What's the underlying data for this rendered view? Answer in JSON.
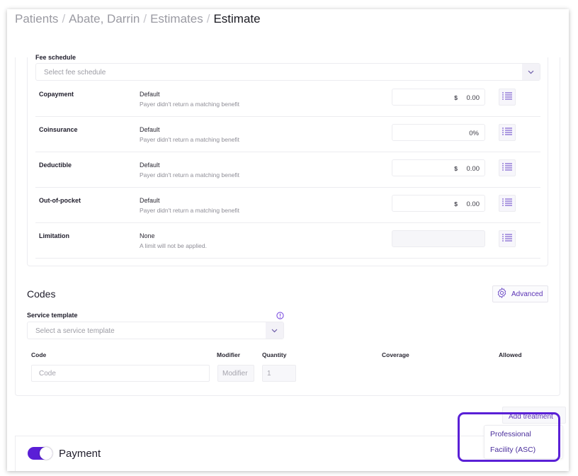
{
  "breadcrumb": {
    "items": [
      "Patients",
      "Abate, Darrin",
      "Estimates"
    ],
    "current": "Estimate",
    "separator": "/"
  },
  "fee_schedule": {
    "label": "Fee schedule",
    "placeholder": "Select fee schedule"
  },
  "benefits": [
    {
      "name": "Copayment",
      "value": "Default",
      "note": "Payer didn't return a matching benefit",
      "currency": "$",
      "amount": "0.00"
    },
    {
      "name": "Coinsurance",
      "value": "Default",
      "note": "Payer didn't return a matching benefit",
      "percent": "0%"
    },
    {
      "name": "Deductible",
      "value": "Default",
      "note": "Payer didn't return a matching benefit",
      "currency": "$",
      "amount": "0.00"
    },
    {
      "name": "Out-of-pocket",
      "value": "Default",
      "note": "Payer didn't return a matching benefit",
      "currency": "$",
      "amount": "0.00"
    },
    {
      "name": "Limitation",
      "value": "None",
      "note": "A limit will not be applied.",
      "amount": ""
    }
  ],
  "codes": {
    "title": "Codes",
    "advanced_label": "Advanced",
    "service_template_label": "Service template",
    "service_template_placeholder": "Select a service template",
    "columns": [
      "Code",
      "Modifier",
      "Quantity",
      "Coverage",
      "Allowed"
    ],
    "code_placeholder": "Code",
    "modifier_placeholder": "Modifier",
    "quantity_value": "1"
  },
  "add_treatment": {
    "label": "Add treatment",
    "options": [
      "Professional",
      "Facility (ASC)"
    ]
  },
  "payment": {
    "label": "Payment",
    "enabled": true
  },
  "colors": {
    "accent": "#5a1fd6",
    "accent_text": "#5b33b5",
    "border": "#ececf0"
  }
}
